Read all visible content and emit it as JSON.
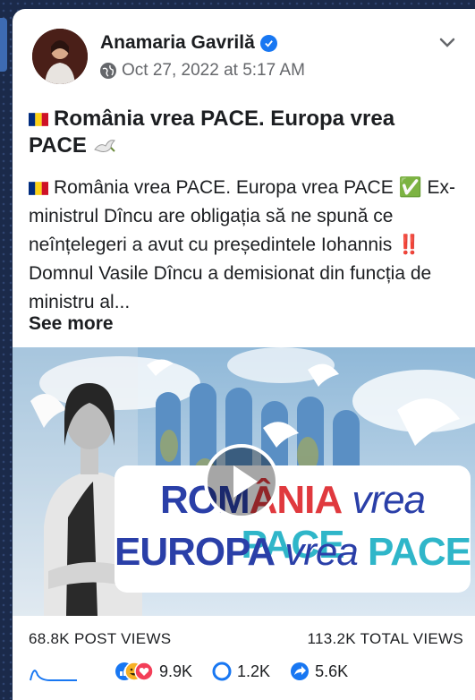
{
  "post": {
    "author": "Anamaria Gavrilă",
    "timestamp": "Oct 27, 2022 at 5:17 AM",
    "title": "România vrea PACE. Europa vrea PACE",
    "body": "România vrea PACE. Europa vrea PACE ✅ Ex-ministrul Dîncu are obligația să ne spună ce neînțelegeri a avut cu președintele Iohannis ‼️ Domnul Vasile Dîncu a demisionat din funcția de ministru al...",
    "see_more": "See more"
  },
  "media": {
    "banner_line1_part1": "ROM",
    "banner_line1_part2": "ÂNIA",
    "banner_line1_part3": " vrea ",
    "banner_line1_part4": "PACE",
    "banner_line2_part1": "EUROPA",
    "banner_line2_part2": " vrea ",
    "banner_line2_part3": "PACE"
  },
  "stats": {
    "post_views": "68.8K POST VIEWS",
    "total_views": "113.2K TOTAL VIEWS"
  },
  "engagement": {
    "reactions": "9.9K",
    "comments": "1.2K",
    "shares": "5.6K"
  },
  "colors": {
    "verified": "#1877f2",
    "flag_blue": "#002b7f",
    "flag_yellow": "#fcd116",
    "flag_red": "#ce1126",
    "banner_blue": "#2a3fa8",
    "banner_teal": "#2fb6c9",
    "banner_red": "#e0393e"
  }
}
